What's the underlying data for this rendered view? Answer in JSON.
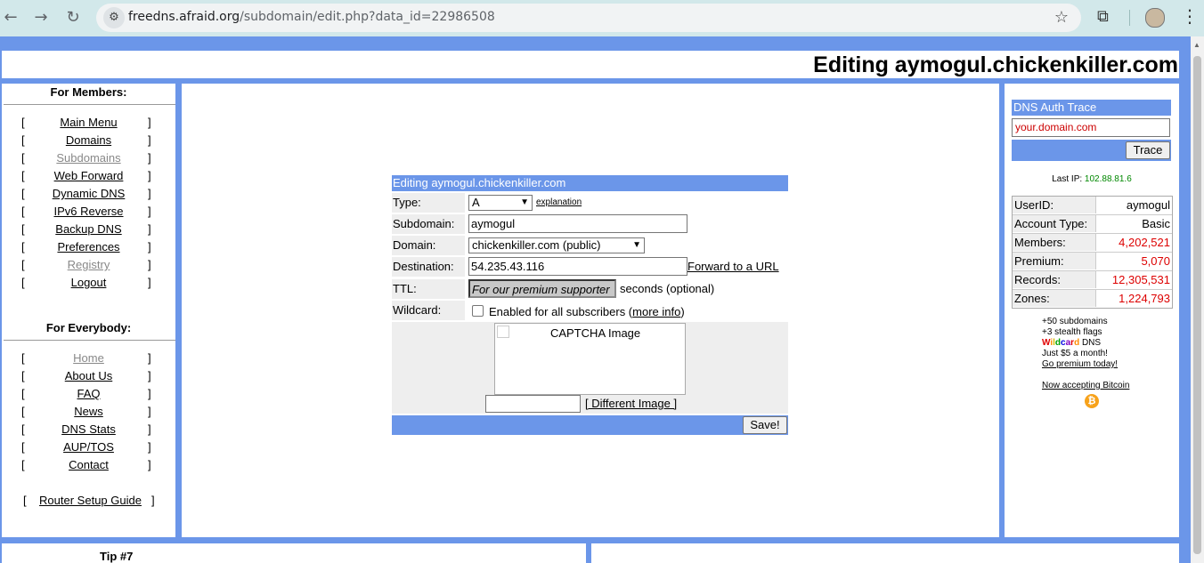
{
  "browser": {
    "back_icon": "←",
    "forward_icon": "→",
    "reload_icon": "↻",
    "url_host": "freedns.afraid.org",
    "url_path": "/subdomain/edit.php?data_id=22986508",
    "star_icon": "☆",
    "extensions_icon": "⧉",
    "menu_icon": "⋮"
  },
  "page": {
    "title": "Editing aymogul.chickenkiller.com"
  },
  "members": {
    "heading": "For Members:",
    "items": [
      {
        "label": "Main Menu"
      },
      {
        "label": "Domains"
      },
      {
        "label": "Subdomains"
      },
      {
        "label": "Web Forward"
      },
      {
        "label": "Dynamic DNS"
      },
      {
        "label": "IPv6 Reverse"
      },
      {
        "label": "Backup DNS"
      },
      {
        "label": "Preferences"
      },
      {
        "label": "Registry"
      },
      {
        "label": "Logout"
      }
    ]
  },
  "everybody": {
    "heading": "For Everybody:",
    "items": [
      {
        "label": "Home"
      },
      {
        "label": "About Us"
      },
      {
        "label": "FAQ"
      },
      {
        "label": "News"
      },
      {
        "label": "DNS Stats"
      },
      {
        "label": "AUP/TOS"
      },
      {
        "label": "Contact"
      }
    ],
    "router_guide": "Router Setup Guide"
  },
  "brackets": {
    "open": "[",
    "close": "]"
  },
  "form": {
    "heading": "Editing aymogul.chickenkiller.com",
    "type_label": "Type:",
    "type_value": "A",
    "explanation_link": "explanation",
    "subdomain_label": "Subdomain:",
    "subdomain_value": "aymogul",
    "domain_label": "Domain:",
    "domain_value": "chickenkiller.com (public)",
    "destination_label": "Destination:",
    "destination_value": "54.235.43.116",
    "forward_link": "Forward to a URL",
    "ttl_label": "TTL:",
    "ttl_value": "For our premium supporter",
    "ttl_suffix": "seconds (optional)",
    "wildcard_label": "Wildcard:",
    "wildcard_text": "Enabled for all subscribers (",
    "more_info_link": "more info",
    "wildcard_close": ")",
    "captcha_alt": "CAPTCHA Image",
    "different_image_link": "[ Different Image ]",
    "save_button": "Save!",
    "dropdown_icon": "▼"
  },
  "trace": {
    "heading": "DNS Auth Trace",
    "input_value": "your.domain.com",
    "button": "Trace"
  },
  "last_ip": {
    "label": "Last IP:",
    "value": "102.88.81.6"
  },
  "stats": [
    {
      "key": "UserID:",
      "value": "aymogul",
      "red": false
    },
    {
      "key": "Account Type:",
      "value": "Basic",
      "red": false
    },
    {
      "key": "Members:",
      "value": "4,202,521",
      "red": true
    },
    {
      "key": "Premium:",
      "value": "5,070",
      "red": true
    },
    {
      "key": "Records:",
      "value": "12,305,531",
      "red": true
    },
    {
      "key": "Zones:",
      "value": "1,224,793",
      "red": true
    }
  ],
  "promo": {
    "line1": "+50 subdomains",
    "line2": "+3 stealth flags",
    "line3_rest": " DNS",
    "line4": "Just $5 a month!",
    "link": "Go premium today!",
    "bitcoin": "Now accepting Bitcoin",
    "bitcoin_icon": "₿",
    "wildcard_word": "Wildcard",
    "wildcard_colors": [
      "#e00000",
      "#ff8c00",
      "#d4c000",
      "#00a000",
      "#0000e0",
      "#8000c0",
      "#e00000",
      "#ff8c00"
    ]
  },
  "footer": {
    "tip": "Tip #7"
  }
}
